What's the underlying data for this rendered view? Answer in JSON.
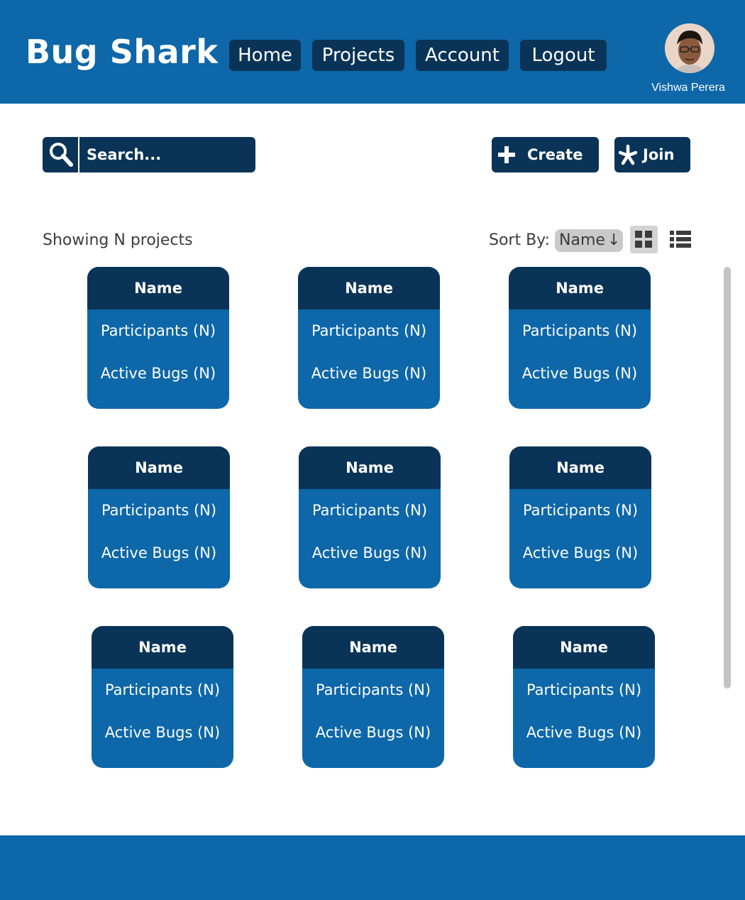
{
  "app": {
    "title": "Bug Shark"
  },
  "nav": {
    "items": [
      {
        "label": "Home"
      },
      {
        "label": "Projects"
      },
      {
        "label": "Account"
      },
      {
        "label": "Logout"
      }
    ]
  },
  "user": {
    "name": "Vishwa Perera",
    "avatar_icon": "user-avatar-photo"
  },
  "search": {
    "placeholder": "Search...",
    "icon": "search-icon"
  },
  "actions": {
    "create_label": "Create",
    "create_icon": "plus-icon",
    "join_label": "Join",
    "join_icon": "asterisk-icon"
  },
  "toolbar": {
    "showing_text": "Showing N projects",
    "sort_label": "Sort By:",
    "sort_value": "Name",
    "sort_direction": "↓",
    "grid_view_icon": "grid-view-icon",
    "list_view_icon": "list-view-icon",
    "active_view": "grid"
  },
  "projects": [
    {
      "name": "Name",
      "participants": "Participants (N)",
      "bugs": "Active Bugs (N)"
    },
    {
      "name": "Name",
      "participants": "Participants (N)",
      "bugs": "Active Bugs (N)"
    },
    {
      "name": "Name",
      "participants": "Participants (N)",
      "bugs": "Active Bugs (N)"
    },
    {
      "name": "Name",
      "participants": "Participants (N)",
      "bugs": "Active Bugs (N)"
    },
    {
      "name": "Name",
      "participants": "Participants (N)",
      "bugs": "Active Bugs (N)"
    },
    {
      "name": "Name",
      "participants": "Participants (N)",
      "bugs": "Active Bugs (N)"
    },
    {
      "name": "Name",
      "participants": "Participants (N)",
      "bugs": "Active Bugs (N)"
    },
    {
      "name": "Name",
      "participants": "Participants (N)",
      "bugs": "Active Bugs (N)"
    },
    {
      "name": "Name",
      "participants": "Participants (N)",
      "bugs": "Active Bugs (N)"
    }
  ],
  "colors": {
    "primary": "#0d67a8",
    "dark": "#0a3457",
    "text_muted": "#3c3c3c",
    "sort_bg": "#c9c9c9",
    "scrollbar": "#c4c4c4"
  }
}
